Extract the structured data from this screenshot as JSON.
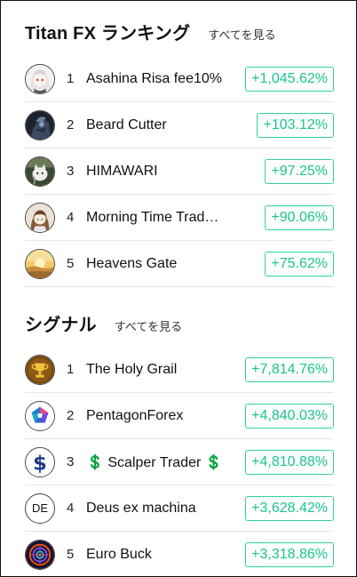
{
  "ranking": {
    "title": "Titan FX ランキング",
    "see_all": "すべてを見る",
    "items": [
      {
        "rank": "1",
        "name": "Asahina Risa fee10%",
        "gain": "+1,045.62%",
        "avatar_icon": "anime-girl-avatar-icon"
      },
      {
        "rank": "2",
        "name": "Beard Cutter",
        "gain": "+103.12%",
        "avatar_icon": "dark-character-avatar-icon"
      },
      {
        "rank": "3",
        "name": "HIMAWARI",
        "gain": "+97.25%",
        "avatar_icon": "cat-avatar-icon"
      },
      {
        "rank": "4",
        "name": "Morning Time Trad…",
        "gain": "+90.06%",
        "avatar_icon": "anime-character-avatar-icon"
      },
      {
        "rank": "5",
        "name": "Heavens Gate",
        "gain": "+75.62%",
        "avatar_icon": "sunset-avatar-icon"
      }
    ]
  },
  "signals": {
    "title": "シグナル",
    "see_all": "すべてを見る",
    "items": [
      {
        "rank": "1",
        "name": "The Holy Grail",
        "gain": "+7,814.76%",
        "avatar_icon": "trophy-avatar-icon"
      },
      {
        "rank": "2",
        "name": "PentagonForex",
        "gain": "+4,840.03%",
        "avatar_icon": "pentagon-logo-avatar-icon"
      },
      {
        "rank": "3",
        "name": "💲 Scalper Trader 💲",
        "gain": "+4,810.88%",
        "avatar_icon": "dollar-sign-avatar-icon"
      },
      {
        "rank": "4",
        "name": "Deus ex machina",
        "gain": "+3,628.42%",
        "avatar_text": "DE"
      },
      {
        "rank": "5",
        "name": "Euro Buck",
        "gain": "+3,318.86%",
        "avatar_icon": "fractal-avatar-icon"
      }
    ]
  },
  "colors": {
    "gain_border": "#2ed3a0",
    "gain_text": "#19c48e"
  }
}
